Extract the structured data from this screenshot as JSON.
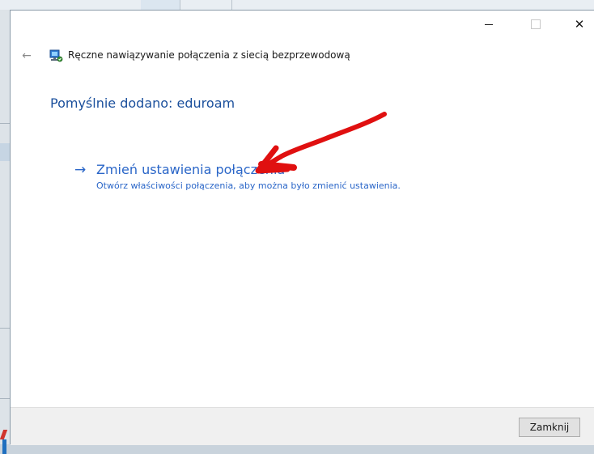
{
  "window": {
    "header_title": "Ręczne nawiązywanie połączenia z siecią bezprzewodową",
    "controls": {
      "minimize_glyph": "",
      "maximize_glyph": "",
      "close_glyph": "✕"
    },
    "back_glyph": "←"
  },
  "content": {
    "success_message": "Pomyślnie dodano: eduroam",
    "link": {
      "arrow_glyph": "→",
      "title": "Zmień ustawienia połączenia",
      "description": "Otwórz właściwości połączenia, aby można było zmienić ustawienia."
    }
  },
  "footer": {
    "close_button_label": "Zamknij"
  },
  "colors": {
    "link": "#2a66c8",
    "heading": "#1a4f9c",
    "annotation": "#e01010"
  },
  "icons": {
    "back": "back-arrow-icon",
    "network": "wireless-network-icon",
    "link_arrow": "arrow-right-icon"
  }
}
